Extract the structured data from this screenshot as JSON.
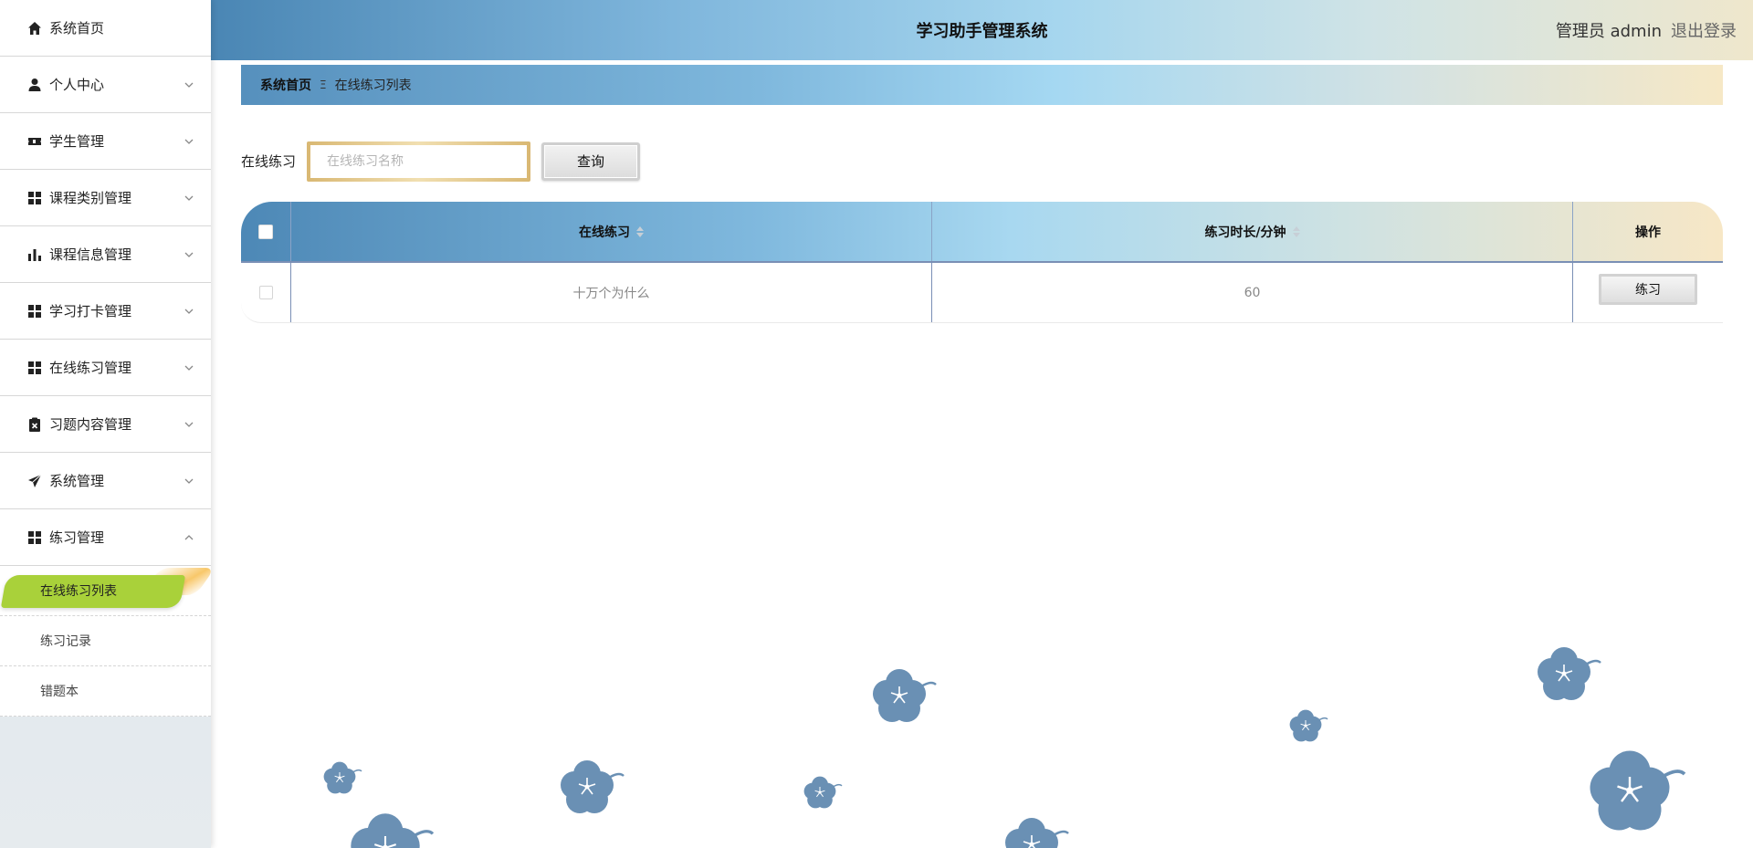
{
  "app": {
    "title": "学习助手管理系统",
    "user_label": "管理员 admin",
    "logout_label": "退出登录"
  },
  "sidebar": {
    "items": [
      {
        "label": "系统首页",
        "icon": "home-icon",
        "expandable": false
      },
      {
        "label": "个人中心",
        "icon": "user-icon",
        "expandable": true
      },
      {
        "label": "学生管理",
        "icon": "ticket-icon",
        "expandable": true
      },
      {
        "label": "课程类别管理",
        "icon": "grid-icon",
        "expandable": true
      },
      {
        "label": "课程信息管理",
        "icon": "bar-chart-icon",
        "expandable": true
      },
      {
        "label": "学习打卡管理",
        "icon": "grid-icon",
        "expandable": true
      },
      {
        "label": "在线练习管理",
        "icon": "grid-icon",
        "expandable": true
      },
      {
        "label": "习题内容管理",
        "icon": "clipboard-icon",
        "expandable": true
      },
      {
        "label": "系统管理",
        "icon": "paper-plane-icon",
        "expandable": true
      },
      {
        "label": "练习管理",
        "icon": "grid-icon",
        "expandable": true,
        "expanded": true
      }
    ],
    "subitems": [
      {
        "label": "在线练习列表",
        "active": true
      },
      {
        "label": "练习记录",
        "active": false
      },
      {
        "label": "错题本",
        "active": false
      }
    ]
  },
  "breadcrumb": {
    "home": "系统首页",
    "separator": "Ξ",
    "current": "在线练习列表"
  },
  "search": {
    "label": "在线练习",
    "placeholder": "在线练习名称",
    "value": "",
    "button_label": "查询"
  },
  "table": {
    "columns": [
      "在线练习",
      "练习时长/分钟",
      "操作"
    ],
    "rows": [
      {
        "name": "十万个为什么",
        "duration": "60",
        "action_label": "练习"
      }
    ]
  },
  "colors": {
    "accent_green": "#a9d13a",
    "header_blue": "#4a86b4",
    "header_sand": "#efe7cc",
    "clover": "#6a90b4"
  }
}
